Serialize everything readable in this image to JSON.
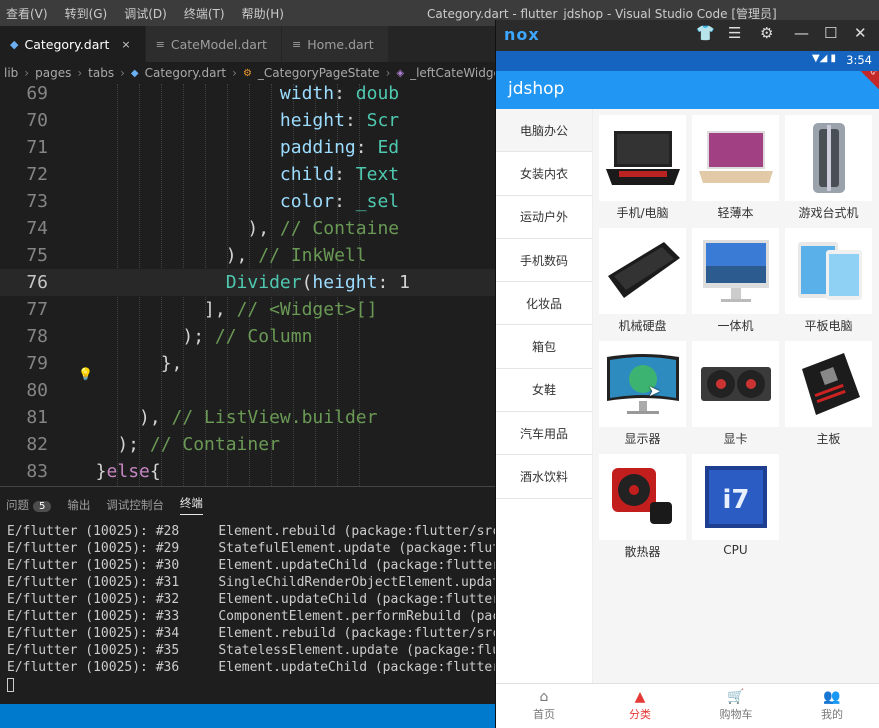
{
  "vscode": {
    "menu": [
      "查看(V)",
      "转到(G)",
      "调试(D)",
      "终端(T)",
      "帮助(H)"
    ],
    "window_title": "Category.dart - flutter_jdshop - Visual Studio Code [管理员]",
    "tabs": [
      {
        "label": "Category.dart",
        "active": true,
        "close": "×"
      },
      {
        "label": "CateModel.dart",
        "active": false
      },
      {
        "label": "Home.dart",
        "active": false
      }
    ],
    "breadcrumb": [
      "lib",
      "pages",
      "tabs",
      "Category.dart",
      "_CategoryPageState",
      "_leftCateWidget"
    ],
    "lines": [
      {
        "n": "69",
        "text": "                   width: doub"
      },
      {
        "n": "70",
        "text": "                   height: Scr"
      },
      {
        "n": "71",
        "text": "                   padding: Ed"
      },
      {
        "n": "72",
        "text": "                   child: Text"
      },
      {
        "n": "73",
        "text": "                   color: _sel"
      },
      {
        "n": "74",
        "text": "                ), // Containe"
      },
      {
        "n": "75",
        "text": "              ), // InkWell"
      },
      {
        "n": "76",
        "text": "              Divider(height: 1"
      },
      {
        "n": "77",
        "text": "            ], // <Widget>[]"
      },
      {
        "n": "78",
        "text": "          ); // Column"
      },
      {
        "n": "79",
        "text": "        },"
      },
      {
        "n": "80",
        "text": ""
      },
      {
        "n": "81",
        "text": "      ), // ListView.builder"
      },
      {
        "n": "82",
        "text": "    ); // Container"
      },
      {
        "n": "83",
        "text": "  }else{"
      }
    ],
    "panel_tabs": {
      "problems": "问题",
      "problems_count": "5",
      "output": "输出",
      "debug_console": "调试控制台",
      "terminal": "终端"
    },
    "terminal": [
      "E/flutter (10025): #28     Element.rebuild (package:flutter/src/widget",
      "E/flutter (10025): #29     StatefulElement.update (package:flutter/src",
      "E/flutter (10025): #30     Element.updateChild (package:flutter/src/wi",
      "E/flutter (10025): #31     SingleChildRenderObjectElement.update (pack",
      "E/flutter (10025): #32     Element.updateChild (package:flutter/src/wi",
      "E/flutter (10025): #33     ComponentElement.performRebuild (package:fl",
      "E/flutter (10025): #34     Element.rebuild (package:flutter/src/widget",
      "E/flutter (10025): #35     StatelessElement.update (package:flutter/sr",
      "E/flutter (10025): #36     Element.updateChild (package:flutter/s"
    ]
  },
  "nox": {
    "logo": "nox",
    "controls": [
      "shirt-icon",
      "menu-icon",
      "gear-icon",
      "minimize-icon",
      "maximize-icon",
      "close-icon"
    ],
    "time": "3:54",
    "debug_ribbon": "DEBUG",
    "app_title": "jdshop",
    "categories": [
      "电脑办公",
      "女装内衣",
      "运动户外",
      "手机数码",
      "化妆品",
      "箱包",
      "女鞋",
      "汽车用品",
      "酒水饮料"
    ],
    "products": [
      "手机/电脑",
      "轻薄本",
      "游戏台式机",
      "机械硬盘",
      "一体机",
      "平板电脑",
      "显示器",
      "显卡",
      "主板",
      "散热器",
      "CPU"
    ],
    "bottom_nav": [
      {
        "label": "首页",
        "icon": "home-icon",
        "active": false
      },
      {
        "label": "分类",
        "icon": "category-icon",
        "active": true
      },
      {
        "label": "购物车",
        "icon": "cart-icon",
        "active": false
      },
      {
        "label": "我的",
        "icon": "people-icon",
        "active": false
      }
    ],
    "colors": {
      "appbar": "#2196f3",
      "status_bar": "#1565c0",
      "active_nav": "#e53935"
    }
  }
}
